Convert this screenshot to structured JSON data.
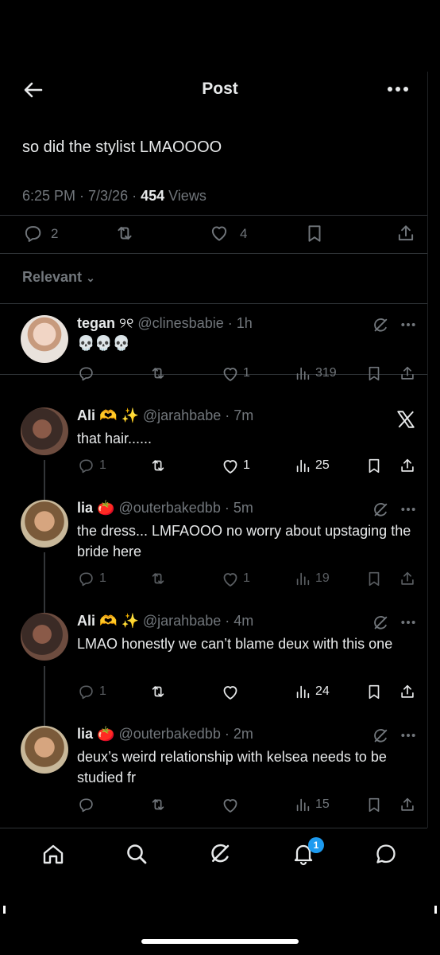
{
  "header": {
    "title": "Post"
  },
  "post": {
    "text": "so did the stylist LMAOOOO",
    "time": "6:25 PM · 7/3/26 · ",
    "views_count": "454",
    "views_label": " Views",
    "replies": "2",
    "likes": "4"
  },
  "filter": {
    "label": "Relevant"
  },
  "replies": [
    {
      "name": "tegan",
      "name_emoji": "୨୧",
      "handle": "@clinesbabie · 1h",
      "text": "💀💀💀",
      "reply_count": "",
      "like_count": "1",
      "views": "319",
      "corner_icon": "grok-icon"
    },
    {
      "name": "Ali",
      "name_emoji": "🫶 ✨",
      "handle": "@jarahbabe · 7m",
      "text": "that hair......",
      "reply_count": "1",
      "like_count": "1",
      "views": "25",
      "corner_icon": "x-logo-icon"
    },
    {
      "name": "lia",
      "name_emoji": "🍅",
      "handle": "@outerbakedbb · 5m",
      "text": "the dress... LMFAOOO no worry about upstaging the bride here",
      "reply_count": "1",
      "like_count": "1",
      "views": "19",
      "corner_icon": "grok-icon"
    },
    {
      "name": "Ali",
      "name_emoji": "🫶 ✨",
      "handle": "@jarahbabe · 4m",
      "text": "LMAO honestly we can’t blame deux with this one",
      "reply_count": "1",
      "like_count": "",
      "views": "24",
      "corner_icon": "grok-icon"
    },
    {
      "name": "lia",
      "name_emoji": "🍅",
      "handle": "@outerbakedbb · 2m",
      "text": "deux’s weird relationship with kelsea needs to be studied fr",
      "reply_count": "",
      "like_count": "",
      "views": "15",
      "corner_icon": "grok-icon"
    }
  ],
  "tabbar": {
    "notification_badge": "1"
  },
  "colors": {
    "background": "#000000",
    "text": "#e7e9ea",
    "muted": "#71767b",
    "accent": "#1d9bf0",
    "separator": "#2f3336"
  }
}
